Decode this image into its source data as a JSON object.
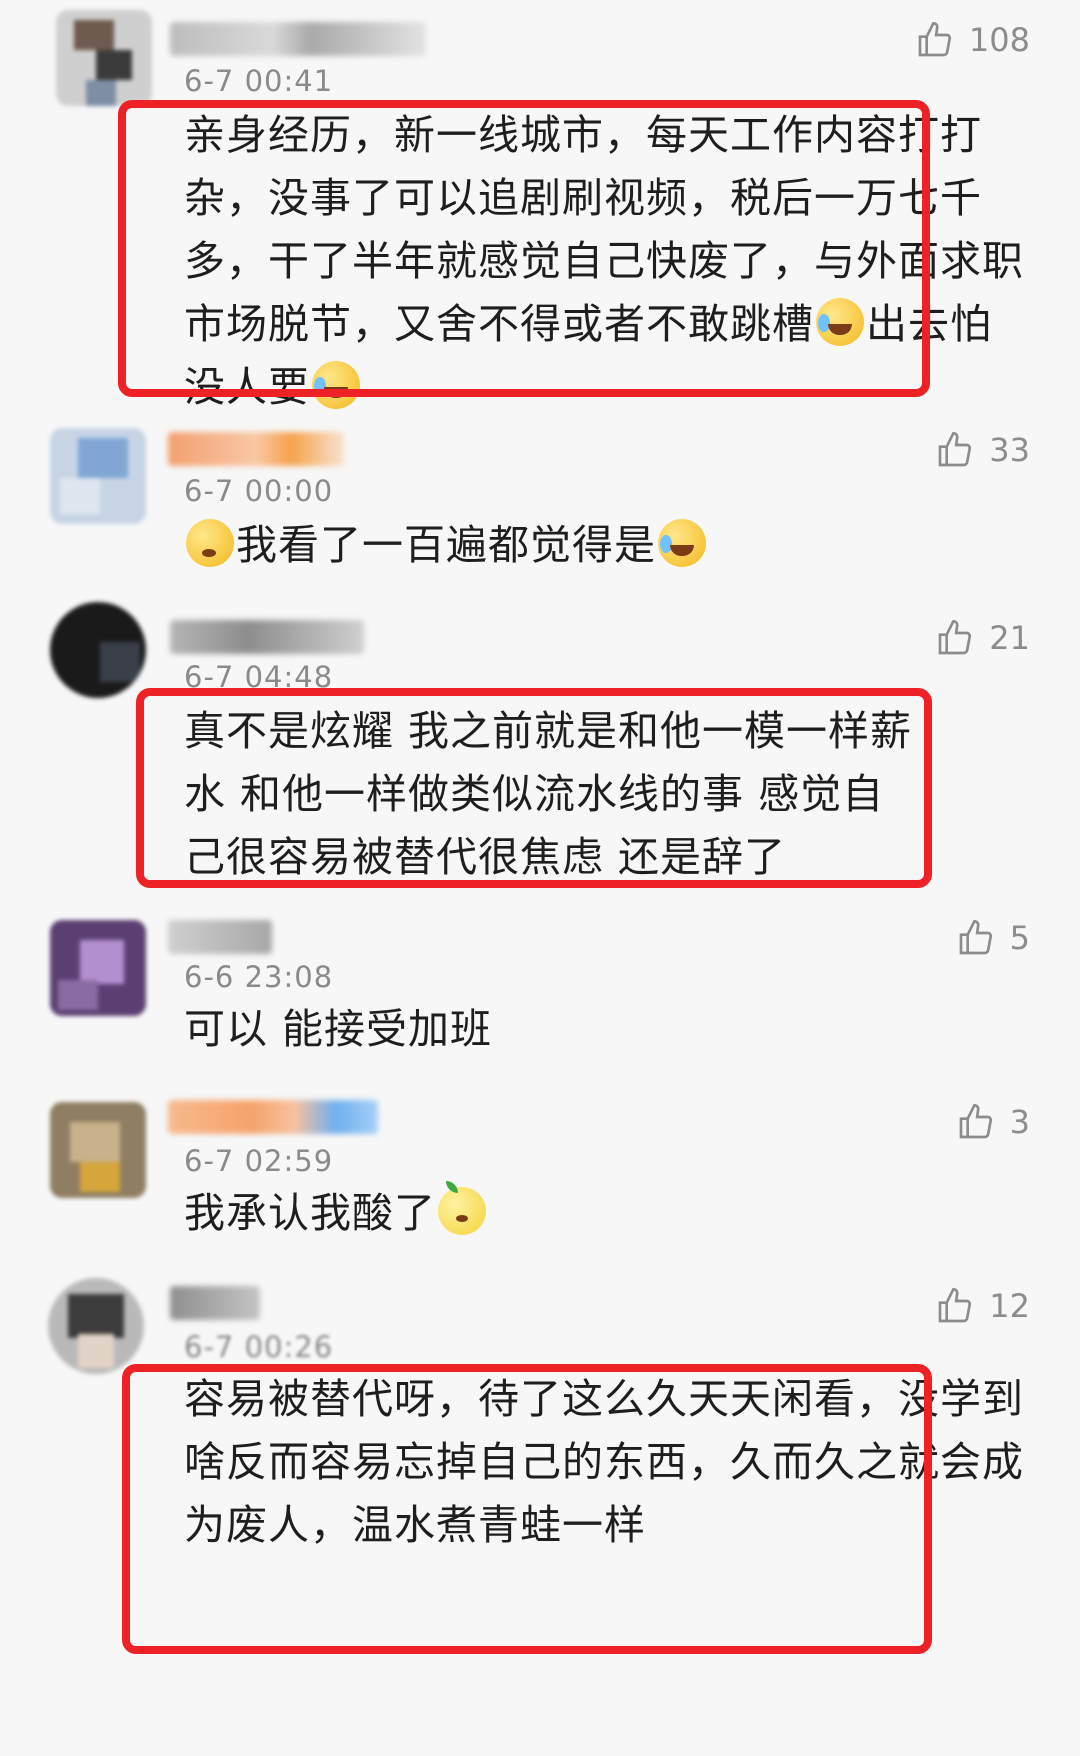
{
  "comments": [
    {
      "time": "6-7 00:41",
      "likes": "108",
      "text_parts": [
        "亲身经历，新一线城市，每天工作内容打打杂，没事了可以追剧刷视频，税后一万七千多，干了半年就感觉自己快废了，与外面求职市场脱节，又舍不得或者不敢跳槽",
        "出去怕没人要"
      ],
      "emoji": [
        "laugh-cry-emoji",
        "laugh-cry-emoji"
      ]
    },
    {
      "time": "6-7 00:00",
      "likes": "33",
      "text_parts": [
        "我看了一百遍都觉得是"
      ],
      "emoji": [
        "thinking-emoji",
        "laugh-cry-emoji"
      ]
    },
    {
      "time": "6-7 04:48",
      "likes": "21",
      "text_parts": [
        "真不是炫耀 我之前就是和他一模一样薪水 和他一样做类似流水线的事 感觉自己很容易被替代很焦虑 还是辞了"
      ]
    },
    {
      "time": "6-6 23:08",
      "likes": "5",
      "text_parts": [
        "可以 能接受加班"
      ]
    },
    {
      "time": "6-7 02:59",
      "likes": "3",
      "text_parts": [
        "我承认我酸了"
      ],
      "emoji": [
        "lemon-emoji"
      ]
    },
    {
      "time": "6-7 00:26",
      "likes": "12",
      "text_parts": [
        "容易被替代呀，待了这么久天天闲看，没学到啥反而容易忘掉自己的东西，久而久之就会成为废人，温水煮青蛙一样"
      ]
    }
  ],
  "colors": {
    "highlight_border": "#ee2127",
    "background": "#f7f7f7",
    "meta_text": "#8a8a8a",
    "body_text": "#1e1e1e"
  },
  "icons": [
    "thumbs-up-icon"
  ]
}
